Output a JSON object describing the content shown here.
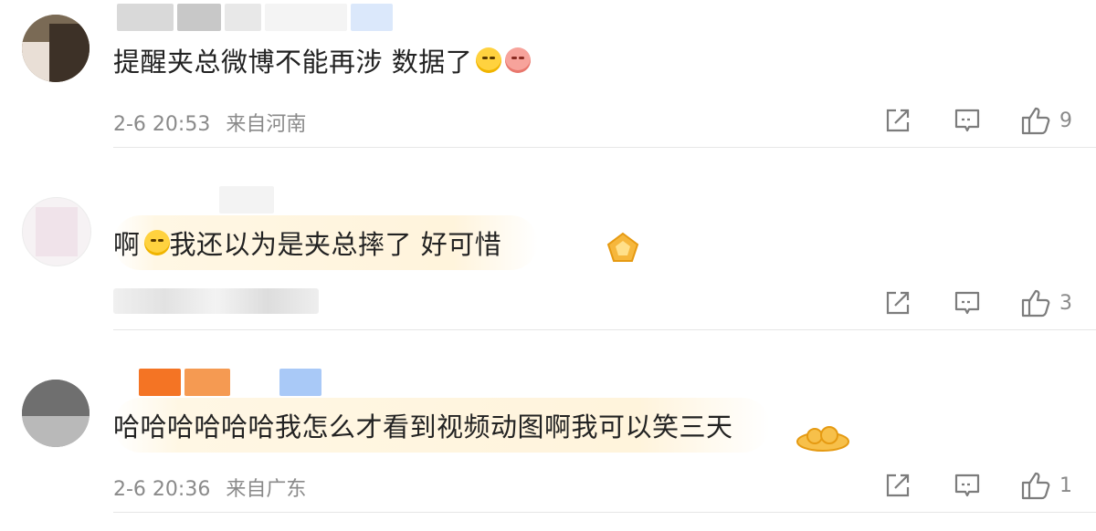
{
  "comments": [
    {
      "text": "提醒夹总微博不能再涉 数据了",
      "emojis": [
        "grin-emoji",
        "pig-emoji"
      ],
      "timestamp": "2-6 20:53",
      "location": "来自河南",
      "likes": "9",
      "has_decoration": false
    },
    {
      "text": "啊",
      "text2": " 我还以为是夹总摔了 好可惜",
      "emojis": [
        "dizzy-emoji"
      ],
      "timestamp": "",
      "location": "",
      "likes": "3",
      "has_decoration": true
    },
    {
      "text": "哈哈哈哈哈哈我怎么才看到视频动图啊我可以笑三天",
      "emojis": [],
      "timestamp": "2-6 20:36",
      "location": "来自广东",
      "likes": "1",
      "has_decoration": true
    }
  ],
  "icons": {
    "share": "share-icon",
    "reply": "comment-icon",
    "like": "thumbs-up-icon"
  },
  "colors": {
    "meta_text": "#8a8a8a",
    "icon_stroke": "#7c7c7c",
    "badge_gold": "#f6b73c"
  }
}
